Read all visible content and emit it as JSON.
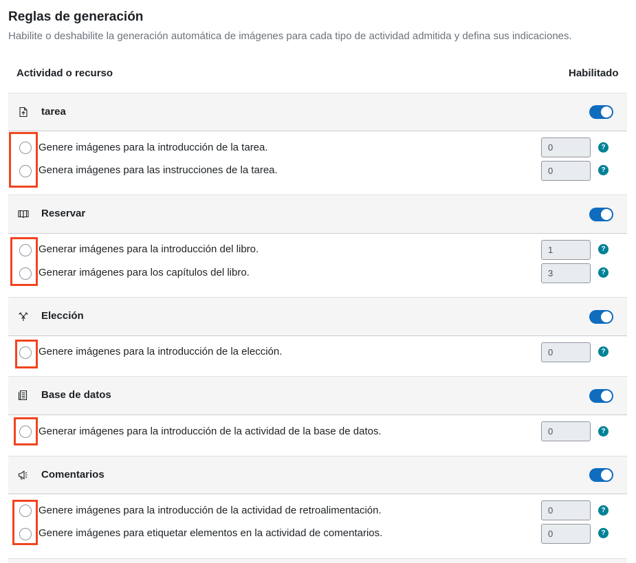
{
  "header": {
    "title": "Reglas de generación",
    "subtitle": "Habilite o deshabilite la generación automática de imágenes para cada tipo de actividad admitida y defina sus indicaciones."
  },
  "table": {
    "col_activity": "Actividad o recurso",
    "col_enabled": "Habilitado"
  },
  "groups": [
    {
      "name": "tarea",
      "icon": "assignment-upload-icon",
      "enabled": true,
      "options": [
        {
          "label": "Genere imágenes para la introducción de la tarea.",
          "value": "0"
        },
        {
          "label": "Genera imágenes para las instrucciones de la tarea.",
          "value": "0"
        }
      ]
    },
    {
      "name": "Reservar",
      "icon": "book-icon",
      "enabled": true,
      "options": [
        {
          "label": "Generar imágenes para la introducción del libro.",
          "value": "1"
        },
        {
          "label": "Generar imágenes para los capítulos del libro.",
          "value": "3"
        }
      ]
    },
    {
      "name": "Elección",
      "icon": "choice-icon",
      "enabled": true,
      "options": [
        {
          "label": "Genere imágenes para la introducción de la elección.",
          "value": "0"
        }
      ]
    },
    {
      "name": "Base de datos",
      "icon": "database-icon",
      "enabled": true,
      "options": [
        {
          "label": "Generar imágenes para la introducción de la actividad de la base de datos.",
          "value": "0"
        }
      ]
    },
    {
      "name": "Comentarios",
      "icon": "feedback-megaphone-icon",
      "enabled": true,
      "options": [
        {
          "label": "Genere imágenes para la introducción de la actividad de retroalimentación.",
          "value": "0"
        },
        {
          "label": "Genere imágenes para etiquetar elementos en la actividad de comentarios.",
          "value": "0"
        }
      ]
    }
  ],
  "help_glyph": "?",
  "colors": {
    "accent": "#0f6cbf",
    "help": "#008196",
    "highlight": "#f0441f"
  }
}
